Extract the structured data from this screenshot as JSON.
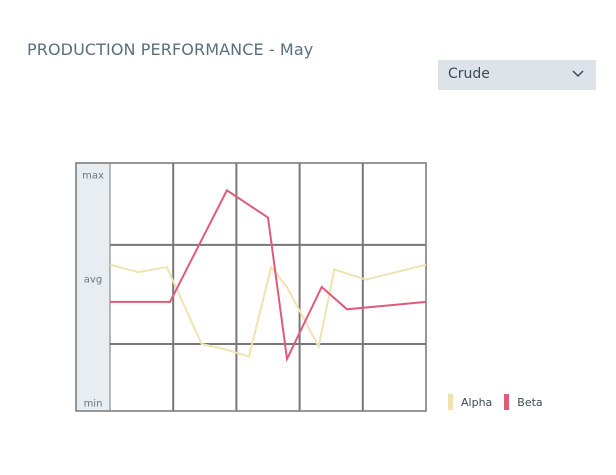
{
  "header": {
    "title": "PRODUCTION PERFORMANCE - May"
  },
  "product_select": {
    "value": "Crude",
    "icon": "chevron-down-icon"
  },
  "colors": {
    "alpha": "#f1e2b2",
    "beta": "#e05a7a",
    "grid": "#777777",
    "axis_band": "#e8edf1",
    "title": "#5b6e7d"
  },
  "chart_data": {
    "type": "line",
    "title": "PRODUCTION PERFORMANCE - May",
    "ylim": [
      0,
      10
    ],
    "y_tick_labels": [
      "max",
      "avg",
      "min"
    ],
    "y_tick_values": [
      9.5,
      5.3,
      0.3
    ],
    "xlim": [
      0,
      5
    ],
    "grid": true,
    "legend_position": "bottom-right",
    "series": [
      {
        "name": "Alpha",
        "color": "#f1e2b2",
        "x": [
          0,
          0.45,
          0.9,
          1.45,
          1.8,
          2.2,
          2.55,
          2.8,
          3.3,
          3.55,
          4.05,
          5.0
        ],
        "y": [
          5.9,
          5.6,
          5.8,
          2.7,
          2.5,
          2.2,
          5.8,
          5.0,
          2.6,
          5.7,
          5.3,
          5.9
        ]
      },
      {
        "name": "Beta",
        "color": "#e05a7a",
        "x": [
          0,
          0.95,
          1.85,
          2.5,
          2.8,
          3.35,
          3.75,
          5.0
        ],
        "y": [
          4.4,
          4.4,
          8.9,
          7.8,
          2.1,
          5.0,
          4.1,
          4.4
        ]
      }
    ]
  },
  "legend": [
    {
      "label": "Alpha",
      "color": "#f1e2b2"
    },
    {
      "label": "Beta",
      "color": "#e05a7a"
    }
  ]
}
